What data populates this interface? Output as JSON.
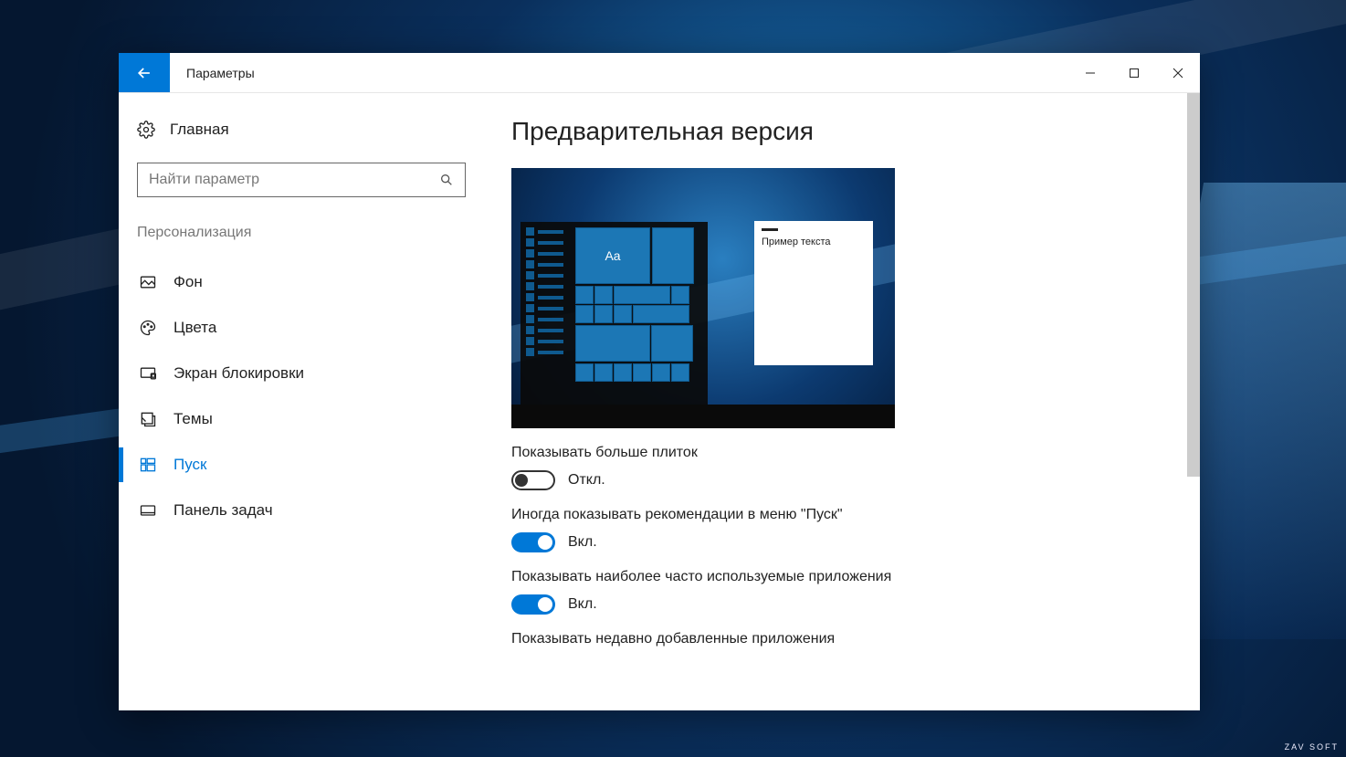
{
  "watermark": "ZAV SOFT",
  "window": {
    "title": "Параметры"
  },
  "sidebar": {
    "home": "Главная",
    "search_placeholder": "Найти параметр",
    "section": "Персонализация",
    "items": [
      {
        "key": "background",
        "label": "Фон"
      },
      {
        "key": "colors",
        "label": "Цвета"
      },
      {
        "key": "lock-screen",
        "label": "Экран блокировки"
      },
      {
        "key": "themes",
        "label": "Темы"
      },
      {
        "key": "start",
        "label": "Пуск"
      },
      {
        "key": "taskbar",
        "label": "Панель задач"
      }
    ]
  },
  "content": {
    "title": "Предварительная версия",
    "preview": {
      "aa": "Aa",
      "sample_text": "Пример текста"
    },
    "settings": [
      {
        "key": "more-tiles",
        "label": "Показывать больше плиток",
        "on": false,
        "state": "Откл."
      },
      {
        "key": "recommendations",
        "label": "Иногда показывать рекомендации в меню \"Пуск\"",
        "on": true,
        "state": "Вкл."
      },
      {
        "key": "most-used",
        "label": "Показывать наиболее часто используемые приложения",
        "on": true,
        "state": "Вкл."
      },
      {
        "key": "recently-added",
        "label": "Показывать недавно добавленные приложения",
        "on": null,
        "state": ""
      }
    ]
  }
}
